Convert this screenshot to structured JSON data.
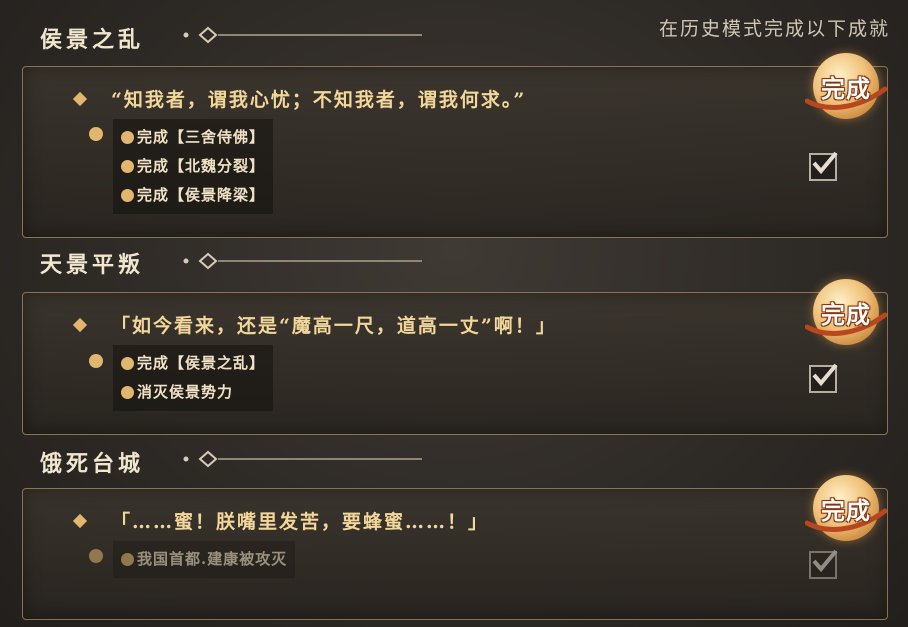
{
  "header_note": "在历史模式完成以下成就",
  "badge_label": "完成",
  "colors": {
    "accent": "#e2b66f",
    "quote": "#f3d79a",
    "frame": "#8a7352"
  },
  "achievements": [
    {
      "title": "侯景之乱",
      "quote": "“知我者，谓我心忧；不知我者，谓我何求。”",
      "requirements": [
        "完成【三舍侍佛】",
        "完成【北魏分裂】",
        "完成【侯景降梁】"
      ],
      "checked": true
    },
    {
      "title": "天景平叛",
      "quote": "「如今看来，还是“魔高一尺，道高一丈”啊！」",
      "requirements": [
        "完成【侯景之乱】",
        "消灭侯景势力"
      ],
      "checked": true
    },
    {
      "title": "饿死台城",
      "quote": "「……蜜！朕嘴里发苦，要蜂蜜……！」",
      "requirements": [
        "我国首都.建康被攻灭"
      ],
      "checked": true
    }
  ]
}
